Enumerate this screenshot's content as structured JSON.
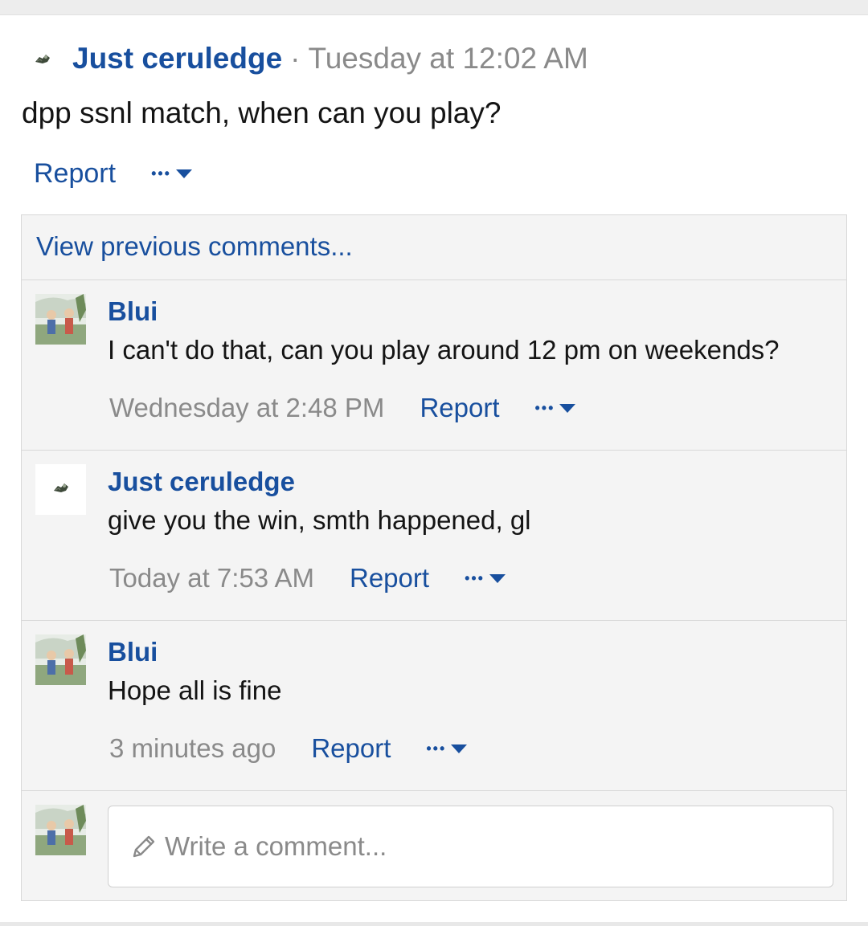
{
  "post": {
    "author": "Just ceruledge",
    "separator": "·",
    "time": "Tuesday at 12:02 AM",
    "body": "dpp ssnl match, when can you play?",
    "report_label": "Report",
    "more_dots": "•••",
    "avatar_icon": "pokemon-sprite-icon"
  },
  "comments": {
    "view_previous": "View previous comments...",
    "items": [
      {
        "author": "Blui",
        "text": "I can't do that, can you play around 12 pm on weekends?",
        "time": "Wednesday at 2:48 PM",
        "report_label": "Report",
        "more_dots": "•••",
        "avatar": "illustrated-avatar"
      },
      {
        "author": "Just ceruledge",
        "text": "give you the win, smth happened, gl",
        "time": "Today at 7:53 AM",
        "report_label": "Report",
        "more_dots": "•••",
        "avatar": "pokemon-sprite-icon"
      },
      {
        "author": "Blui",
        "text": "Hope all is fine",
        "time": "3 minutes ago",
        "report_label": "Report",
        "more_dots": "•••",
        "avatar": "illustrated-avatar"
      }
    ],
    "write_placeholder": "Write a comment..."
  },
  "colors": {
    "link": "#184f9e",
    "muted": "#8a8a8a",
    "panel": "#f4f4f4",
    "border": "#d8d8d8"
  }
}
